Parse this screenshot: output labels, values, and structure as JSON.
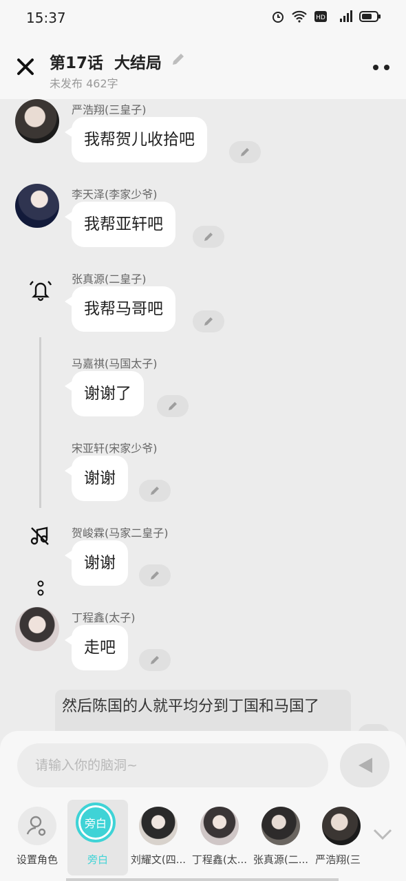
{
  "status": {
    "time": "15:37"
  },
  "header": {
    "title": "第17话  大结局",
    "subtitle": "未发布 462字"
  },
  "messages": [
    {
      "name": "严浩翔(三皇子)",
      "text": "我帮贺儿收拾吧"
    },
    {
      "name": "李天泽(李家少爷)",
      "text": "我帮亚轩吧"
    },
    {
      "name": "张真源(二皇子)",
      "text": "我帮马哥吧"
    },
    {
      "name": "马嘉祺(马国太子)",
      "text": "谢谢了"
    },
    {
      "name": "宋亚轩(宋家少爷)",
      "text": "谢谢"
    },
    {
      "name": "贺峻霖(马家二皇子)",
      "text": "谢谢"
    },
    {
      "name": "丁程鑫(太子)",
      "text": "走吧"
    }
  ],
  "narration": "然后陈国的人就平均分到丁国和马国了",
  "composer": {
    "placeholder": "请输入你的脑洞~"
  },
  "roles": [
    {
      "label": "设置角色"
    },
    {
      "label": "旁白",
      "badge": "旁白"
    },
    {
      "label": "刘耀文(四..."
    },
    {
      "label": "丁程鑫(太..."
    },
    {
      "label": "张真源(二..."
    },
    {
      "label": "严浩翔(三"
    }
  ],
  "colors": {
    "accent": "#3fd3d6",
    "bubble": "#ffffff",
    "background": "#ececec"
  }
}
